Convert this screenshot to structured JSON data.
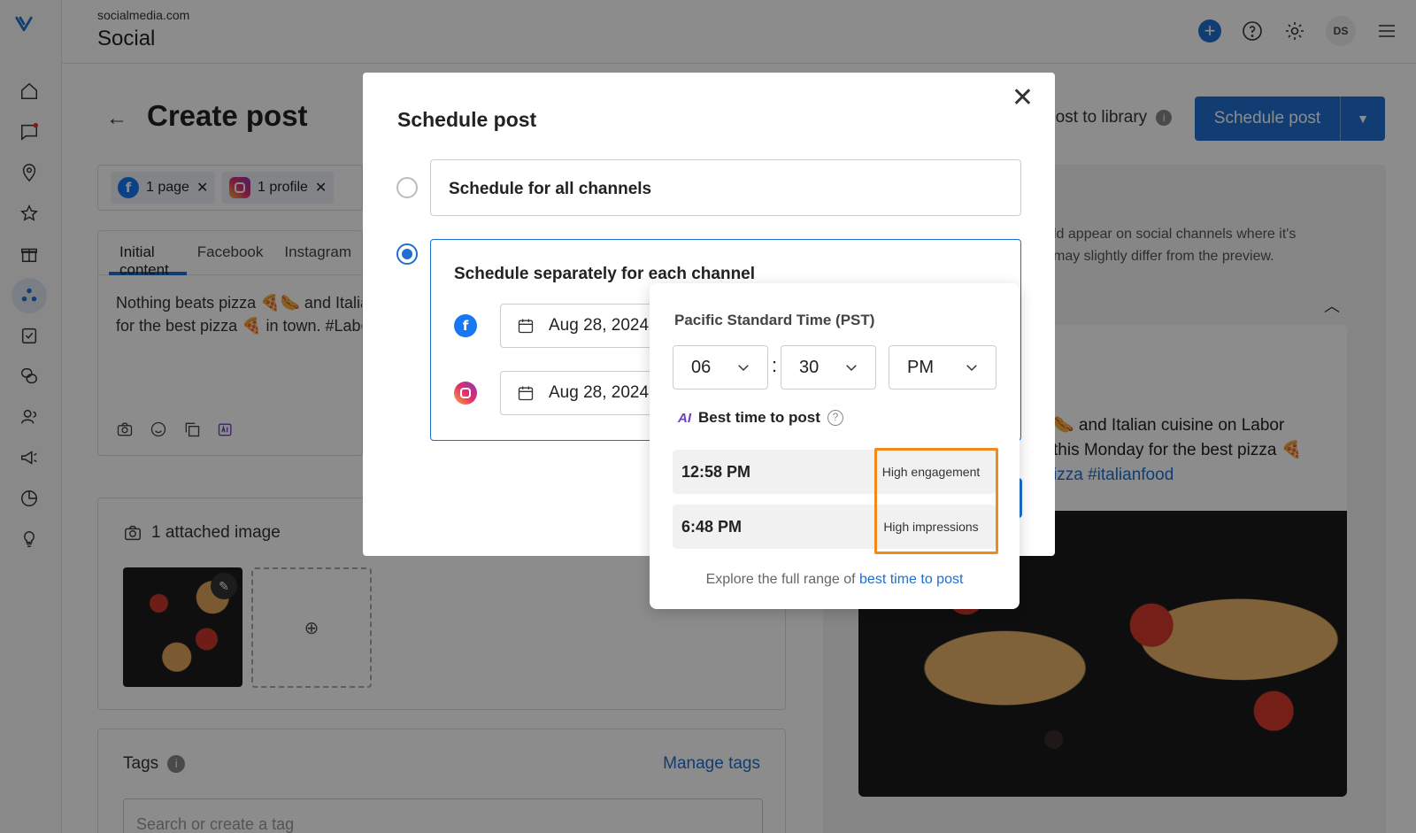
{
  "header": {
    "site": "socialmedia.com",
    "app_title": "Social",
    "avatar_initials": "DS",
    "add_label": "+"
  },
  "page": {
    "title": "Create post",
    "back_label": "←",
    "post_to_library": "Post to library",
    "schedule_post_button": "Schedule post"
  },
  "channels": {
    "facebook_chip": "1 page",
    "instagram_chip": "1 profile"
  },
  "editor": {
    "tabs": [
      "Initial content",
      "Facebook",
      "Instagram"
    ],
    "text_line1": "Nothing beats pizza 🍕🌭 and Italian cuisine on Labor Day",
    "text_line2": "for the best pizza 🍕 in town. #LaborDay"
  },
  "attachments": {
    "title": "1 attached image"
  },
  "tags": {
    "title": "Tags",
    "manage": "Manage tags",
    "placeholder": "Search or create a tag"
  },
  "preview": {
    "note_line1": "ld appear on social channels where it's",
    "note_line2": "may slightly differ from the preview.",
    "text_line1": "🌭 and Italian cuisine on Labor",
    "text_line2": "this Monday for the best pizza 🍕",
    "hashtags": "izza #italianfood"
  },
  "modal": {
    "title": "Schedule post",
    "option_all": "Schedule for all channels",
    "option_separate": "Schedule separately for each channel",
    "facebook_date": "Aug 28, 2024",
    "instagram_date": "Aug 28, 2024"
  },
  "time_picker": {
    "timezone": "Pacific Standard Time (PST)",
    "hour": "06",
    "minute": "30",
    "ampm": "PM",
    "best_time_label": "Best time to post",
    "ai_badge": "AI",
    "suggestions": [
      {
        "time": "12:58 PM",
        "tag": "High engagement"
      },
      {
        "time": "6:48 PM",
        "tag": "High impressions"
      }
    ],
    "explore_prefix": "Explore the full range of ",
    "explore_link": "best time to post"
  },
  "colors": {
    "accent": "#1f6fd0",
    "highlight": "#f08a1c",
    "facebook": "#1877f2"
  }
}
